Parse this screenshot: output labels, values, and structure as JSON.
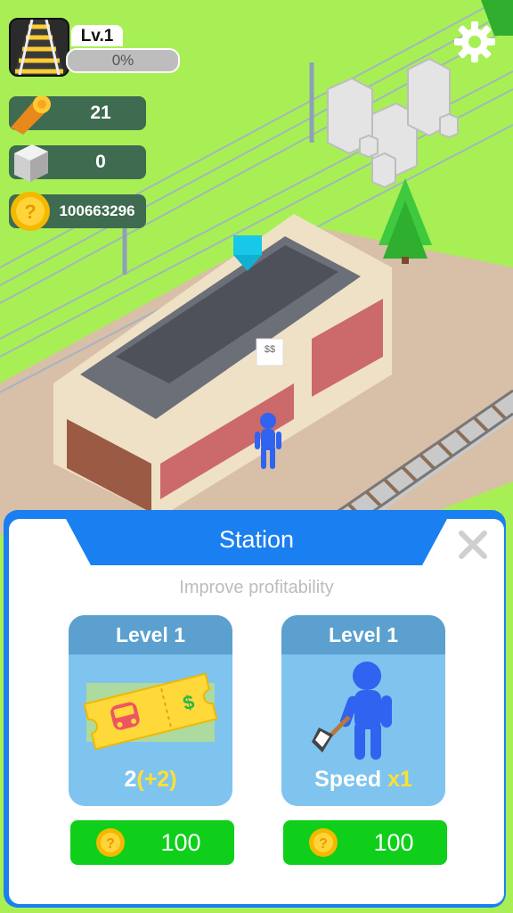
{
  "hud": {
    "level_label": "Lv.1",
    "xp_percent_text": "0%",
    "xp_fraction": 0,
    "resources": [
      {
        "name": "wood",
        "icon": "wood-log-icon",
        "value": "21"
      },
      {
        "name": "stone",
        "icon": "stone-block-icon",
        "value": "0"
      },
      {
        "name": "coins",
        "icon": "coin-icon",
        "value": "100663296"
      }
    ],
    "settings_icon": "gear-icon"
  },
  "station_label": "$$",
  "dialog": {
    "title": "Station",
    "subtitle": "Improve profitability",
    "close_icon": "close-icon",
    "cards": [
      {
        "level": "Level 1",
        "icon": "train-ticket-icon",
        "value_base": "2",
        "value_bonus": "(+2)",
        "price": "100"
      },
      {
        "level": "Level 1",
        "icon": "worker-with-axe-icon",
        "value_base": "Speed ",
        "value_bonus": "x1",
        "price": "100"
      }
    ]
  },
  "colors": {
    "grass": "#a8ef55",
    "panel_blue": "#1a7ff0",
    "card_blue": "#7fc4ee",
    "buy_green": "#0fcf1b",
    "highlight_yellow": "#ffe033"
  }
}
